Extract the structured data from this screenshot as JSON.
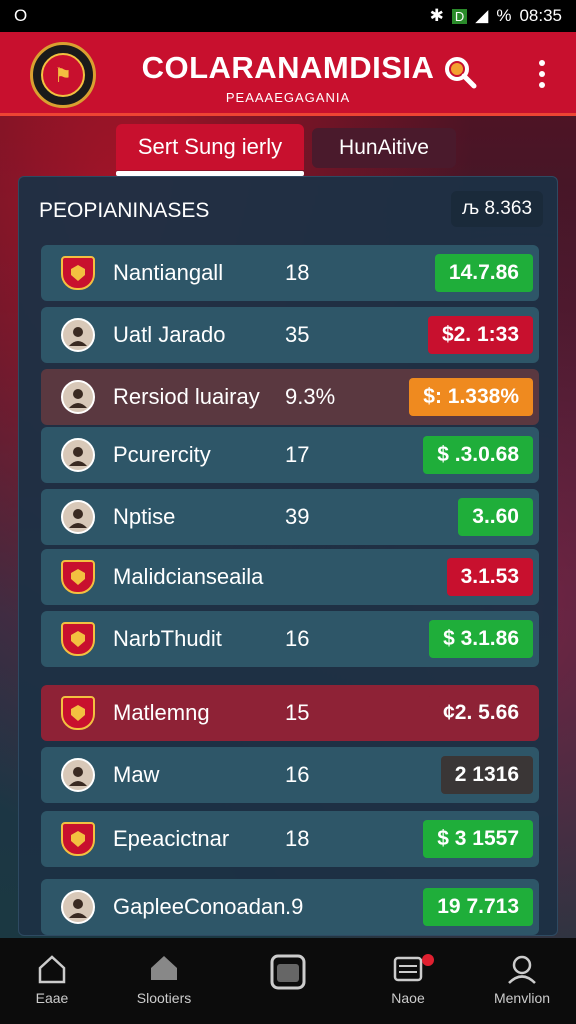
{
  "status_bar": {
    "left_icon": "O",
    "time": "08:35",
    "battery_icon": "D"
  },
  "header": {
    "title": "COLARANAMDISIA",
    "subtitle": "PEAAAEGAGANIA",
    "logo_icon": "team-crest"
  },
  "tabs": [
    {
      "label": "Sert Sung ierly",
      "active": true
    },
    {
      "label": "HunAitive",
      "active": false
    }
  ],
  "panel": {
    "title": "PEOPIANINASES",
    "badge": "љ 8.363",
    "rows": [
      {
        "name": "Nantiangall",
        "num": "18",
        "value": "14.7.86",
        "value_color": "#1fae3a",
        "icon": "crest-icon",
        "style": "normal"
      },
      {
        "name": "Uatl Jarado",
        "num": "35",
        "value": "$2.  1:33",
        "value_color": "#c8102e",
        "icon": "avatar-icon",
        "style": "normal"
      },
      {
        "name": "Rersiod  luairay",
        "num": "9.3%",
        "value": "$: 1.338%",
        "value_color": "#ef8a1f",
        "icon": "avatar-icon",
        "style": "alt"
      },
      {
        "name": "Pcurercity",
        "num": "17",
        "value": "$ .3.0.68",
        "value_color": "#1fae3a",
        "icon": "avatar-icon",
        "style": "normal"
      },
      {
        "name": "Nptise",
        "num": "39",
        "value": "3..60",
        "value_color": "#1fae3a",
        "icon": "avatar-icon",
        "style": "normal"
      },
      {
        "name": "Malidcianseaila",
        "num": "",
        "value": "3.1.53",
        "value_color": "#c8102e",
        "icon": "crest-icon",
        "style": "normal"
      },
      {
        "name": "NarbThudit",
        "num": "16",
        "value": "$ 3.1.86",
        "value_color": "#1fae3a",
        "icon": "crest-icon",
        "style": "normal"
      },
      {
        "name": "Matlemng",
        "num": "15",
        "value": "¢2.  5.66",
        "value_color": "#8e2236",
        "icon": "crest-icon",
        "style": "red"
      },
      {
        "name": "Maw",
        "num": "16",
        "value": "2  1316",
        "value_color": "#3a3636",
        "icon": "avatar-icon",
        "style": "normal"
      },
      {
        "name": "Epeacictnar",
        "num": "18",
        "value": "$  3  1557",
        "value_color": "#1fae3a",
        "icon": "crest-icon",
        "style": "normal"
      },
      {
        "name": "GapleeConoadan",
        "num": ".9",
        "value": "19 7.713",
        "value_color": "#1fae3a",
        "icon": "avatar-icon",
        "style": "normal"
      }
    ]
  },
  "nav": [
    {
      "label": "Eaae",
      "icon": "home-icon"
    },
    {
      "label": "Slootiers",
      "icon": "house-filled-icon"
    },
    {
      "label": "",
      "icon": "square-icon"
    },
    {
      "label": "Naoe",
      "icon": "list-icon"
    },
    {
      "label": "Menvlion",
      "icon": "profile-icon"
    }
  ],
  "colors": {
    "brand_red": "#c8102e",
    "green": "#1fae3a",
    "orange": "#ef8a1f"
  }
}
